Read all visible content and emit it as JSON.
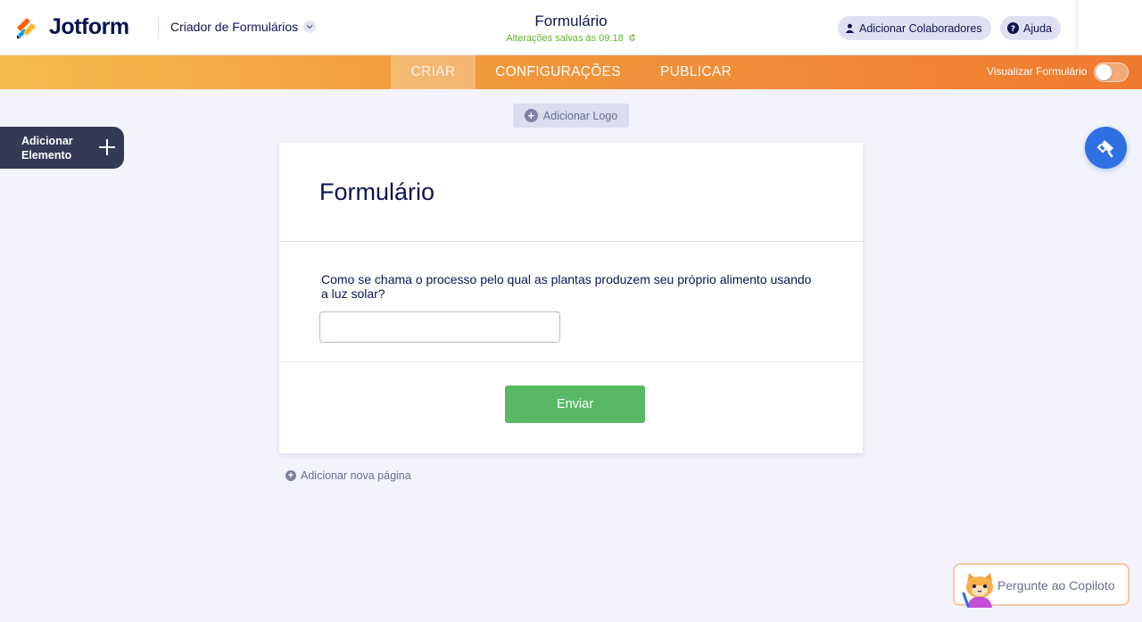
{
  "brand": {
    "name": "Jotform",
    "colors": {
      "navy": "#0a1551",
      "orange": "#ef7a2f",
      "green": "#58b866",
      "blue": "#2f6fe4"
    }
  },
  "header": {
    "builder_label": "Criador de Formulários",
    "form_title": "Formulário",
    "save_status": "Alterações salvas às 09:18",
    "add_collaborators": "Adicionar Colaboradores",
    "help": "Ajuda"
  },
  "nav": {
    "tabs": [
      {
        "label": "CRIAR",
        "active": true
      },
      {
        "label": "CONFIGURAÇÕES",
        "active": false
      },
      {
        "label": "PUBLICAR",
        "active": false
      }
    ],
    "preview_label": "Visualizar Formulário",
    "preview_on": false
  },
  "canvas": {
    "add_logo": "Adicionar Logo",
    "add_element_line1": "Adicionar",
    "add_element_line2": "Elemento",
    "add_page": "Adicionar nova página"
  },
  "form": {
    "heading": "Formulário",
    "question": "Como se chama o processo pelo qual as plantas produzem seu próprio alimento usando a luz solar?",
    "answer_value": "",
    "submit_label": "Enviar"
  },
  "copilot": {
    "label": "Pergunte ao Copiloto"
  },
  "icons": {
    "logo": "jotform-logo-icon",
    "chevron": "chevron-down-icon",
    "refresh": "refresh-icon",
    "user": "user-icon",
    "help": "help-icon",
    "plus": "plus-icon",
    "designer": "paint-roller-icon",
    "copilot_avatar": "cat-avatar-icon"
  }
}
